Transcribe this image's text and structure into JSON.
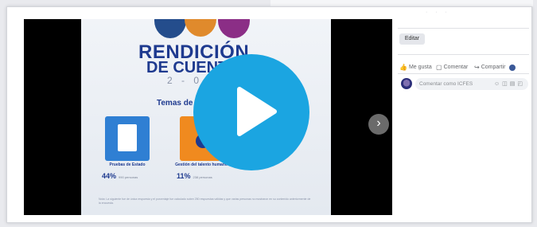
{
  "slide": {
    "title_line1": "RENDICIÓN",
    "title_line2": "DE CUENTAS",
    "year": "2 - 0 - 2",
    "topics_heading": "Temas de ma",
    "cards": [
      {
        "caption": "Pruebas de Estado",
        "percent": "44%",
        "people": "990 personas",
        "color": "#2f7fd3"
      },
      {
        "caption": "Gestión del talento humano",
        "percent": "11%",
        "people": "238 personas",
        "color": "#f08a1f"
      }
    ],
    "note": "Nota: La siguiente fue de única respuesta y el porcentaje fue calculado sobre 250 respuestas válidas y que varias personas no mostraron en su contenido anteriormente de la encuesta."
  },
  "player": {
    "play_icon": "play-icon",
    "next_icon": "chevron-right-icon",
    "accent": "#1ba5e1"
  },
  "sidebar": {
    "edit_label": "Editar",
    "actions": [
      {
        "label": "Me gusta",
        "icon": "like-icon"
      },
      {
        "label": "Comentar",
        "icon": "comment-icon"
      },
      {
        "label": "Compartir",
        "icon": "share-icon"
      }
    ],
    "comment_placeholder": "Comentar como ICFES"
  }
}
